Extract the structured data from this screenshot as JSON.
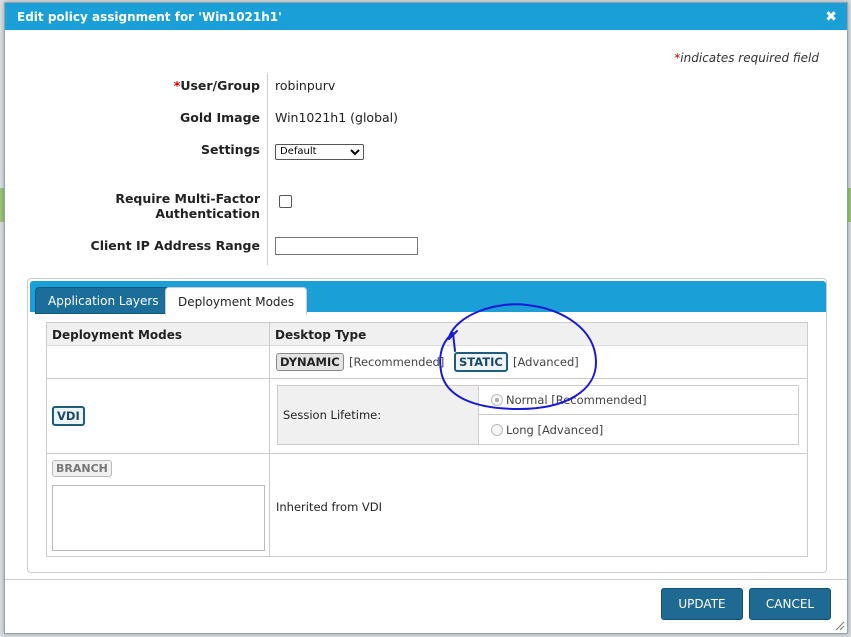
{
  "dialog": {
    "title": "Edit policy assignment for 'Win1021h1'",
    "close_glyph": "✖",
    "required_star": "*",
    "required_note": "indicates required field"
  },
  "form": {
    "user_group_label": "User/Group",
    "user_group_value": "robinpurv",
    "gold_image_label": "Gold Image",
    "gold_image_value": "Win1021h1 (global)",
    "settings_label": "Settings",
    "settings_value": "Default",
    "mfa_label_line1": "Require Multi-Factor",
    "mfa_label_line2": "Authentication",
    "ip_range_label": "Client IP Address Range",
    "ip_range_value": ""
  },
  "tabs": [
    {
      "label": "Application Layers"
    },
    {
      "label": "Deployment Modes"
    }
  ],
  "deployment": {
    "col_modes": "Deployment Modes",
    "col_desktop": "Desktop Type",
    "dynamic_label": "DYNAMIC",
    "dynamic_note": "[Recommended]",
    "static_label": "STATIC",
    "static_note": "[Advanced]",
    "vdi_label": "VDI",
    "session_lifetime_label": "Session Lifetime:",
    "normal_option": "Normal [Recommended]",
    "long_option": "Long [Advanced]",
    "branch_label": "BRANCH",
    "inherited_text": "Inherited from VDI"
  },
  "footer": {
    "update_label": "UPDATE",
    "cancel_label": "CANCEL"
  },
  "colors": {
    "titlebar": "#1a9fd6",
    "button": "#1f6a93",
    "annotation": "#1a1ad6"
  }
}
